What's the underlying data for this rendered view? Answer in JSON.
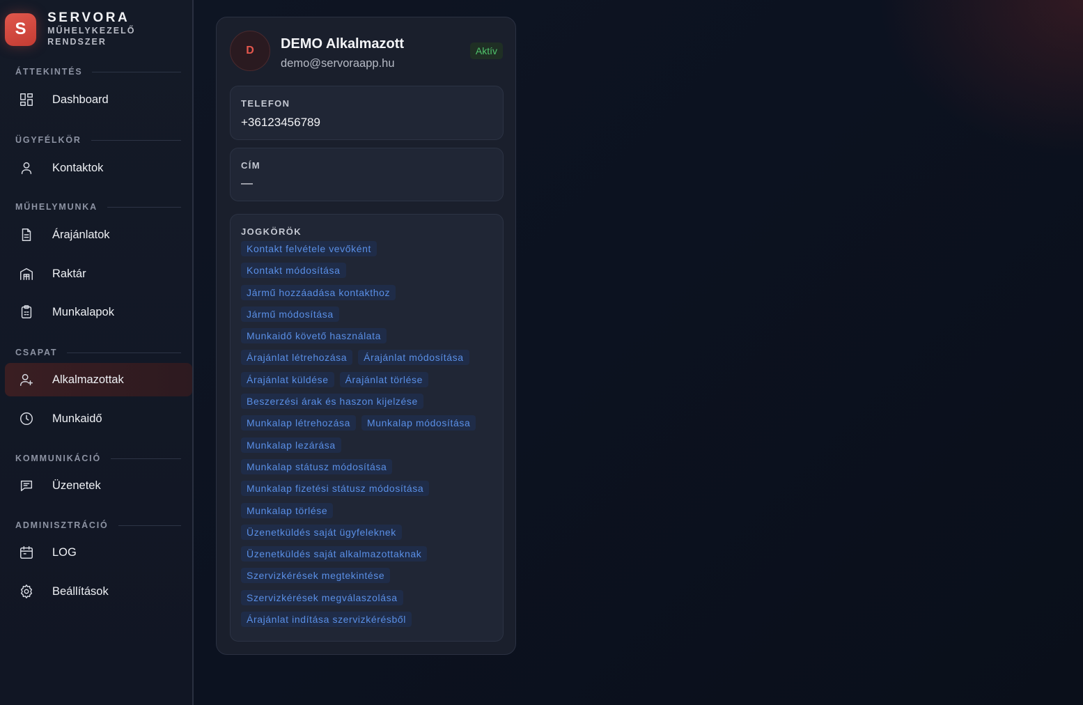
{
  "brand": {
    "logo_letter": "S",
    "name": "SERVORA",
    "subtitle": "MŰHELYKEZELŐ RENDSZER"
  },
  "sidebar": {
    "sections": [
      {
        "label": "ÁTTEKINTÉS",
        "items": [
          {
            "label": "Dashboard",
            "icon": "dashboard-icon"
          }
        ]
      },
      {
        "label": "ÜGYFÉLKÖR",
        "items": [
          {
            "label": "Kontaktok",
            "icon": "user-icon"
          }
        ]
      },
      {
        "label": "MŰHELYMUNKA",
        "items": [
          {
            "label": "Árajánlatok",
            "icon": "document-icon"
          },
          {
            "label": "Raktár",
            "icon": "warehouse-icon"
          },
          {
            "label": "Munkalapok",
            "icon": "clipboard-icon"
          }
        ]
      },
      {
        "label": "CSAPAT",
        "items": [
          {
            "label": "Alkalmazottak",
            "icon": "user-plus-icon",
            "active": true
          },
          {
            "label": "Munkaidő",
            "icon": "clock-icon"
          }
        ]
      },
      {
        "label": "KOMMUNIKÁCIÓ",
        "items": [
          {
            "label": "Üzenetek",
            "icon": "message-icon"
          }
        ]
      },
      {
        "label": "ADMINISZTRÁCIÓ",
        "items": [
          {
            "label": "LOG",
            "icon": "calendar-icon"
          },
          {
            "label": "Beállítások",
            "icon": "gear-icon"
          }
        ]
      }
    ]
  },
  "employee": {
    "avatar_letter": "D",
    "name": "DEMO Alkalmazott",
    "email": "demo@servoraapp.hu",
    "status": "Aktív",
    "phone_label": "TELEFON",
    "phone": "+36123456789",
    "address_label": "CÍM",
    "address": "—",
    "permissions_label": "JOGKÖRÖK",
    "permission_rows": [
      [
        "Kontakt felvétele vevőként"
      ],
      [
        "Kontakt módosítása"
      ],
      [
        "Jármű hozzáadása kontakthoz"
      ],
      [
        "Jármű módosítása"
      ],
      [
        "Munkaidő követő használata"
      ],
      [
        "Árajánlat létrehozása",
        "Árajánlat módosítása"
      ],
      [
        "Árajánlat küldése",
        "Árajánlat törlése"
      ],
      [
        "Beszerzési árak és haszon kijelzése"
      ],
      [
        "Munkalap létrehozása",
        "Munkalap módosítása"
      ],
      [
        "Munkalap lezárása"
      ],
      [
        "Munkalap státusz módosítása"
      ],
      [
        "Munkalap fizetési státusz módosítása"
      ],
      [
        "Munkalap törlése"
      ],
      [
        "Üzenetküldés saját ügyfeleknek"
      ],
      [
        "Üzenetküldés saját alkalmazottaknak"
      ],
      [
        "Szervizkérések megtekintése"
      ],
      [
        "Szervizkérések megválaszolása"
      ],
      [
        "Árajánlat indítása szervizkérésből"
      ]
    ]
  },
  "colors": {
    "accent": "#e0574c",
    "status_green": "#4fc36b",
    "permission_blue": "#5a8fe6"
  }
}
